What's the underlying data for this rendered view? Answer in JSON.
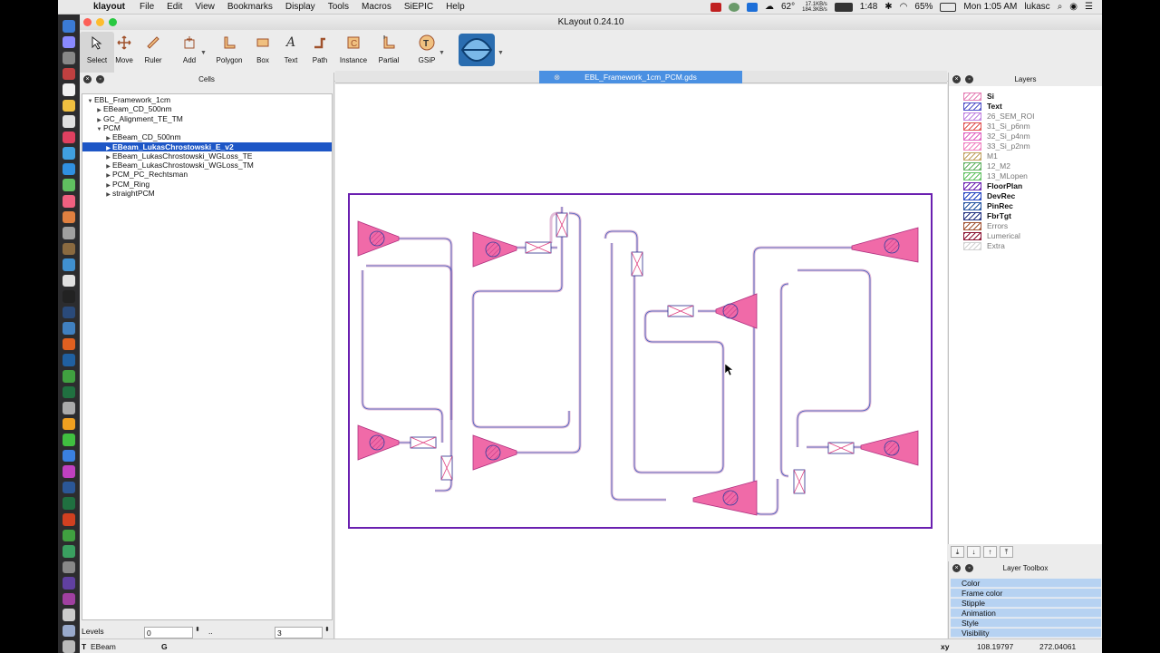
{
  "menubar": {
    "app_name": "klayout",
    "items": [
      "File",
      "Edit",
      "View",
      "Bookmarks",
      "Display",
      "Tools",
      "Macros",
      "SiEPIC",
      "Help"
    ],
    "temperature": "62°",
    "net_up": "17.1KB/s",
    "net_down": "184.3KB/s",
    "battery_time": "1:48",
    "battery_percent": "65%",
    "clock": "Mon 1:05 AM",
    "user": "lukasc"
  },
  "window": {
    "title": "KLayout 0.24.10"
  },
  "toolbar": {
    "tools": [
      {
        "label": "Select",
        "icon": "select-arrow-icon"
      },
      {
        "label": "Move",
        "icon": "move-icon"
      },
      {
        "label": "Ruler",
        "icon": "ruler-icon"
      },
      {
        "label": "Add",
        "icon": "add-icon"
      },
      {
        "label": "Polygon",
        "icon": "polygon-icon"
      },
      {
        "label": "Box",
        "icon": "box-icon"
      },
      {
        "label": "Text",
        "icon": "text-icon"
      },
      {
        "label": "Path",
        "icon": "path-icon"
      },
      {
        "label": "Instance",
        "icon": "instance-icon"
      },
      {
        "label": "Partial",
        "icon": "partial-icon"
      },
      {
        "label": "GSiP",
        "icon": "gsip-icon"
      }
    ]
  },
  "cells": {
    "title": "Cells",
    "tree": [
      {
        "label": "EBL_Framework_1cm",
        "arrow": "▼",
        "selected": false
      },
      {
        "label": "EBeam_CD_500nm",
        "arrow": "▶",
        "selected": false
      },
      {
        "label": "GC_Alignment_TE_TM",
        "arrow": "▶",
        "selected": false
      },
      {
        "label": "PCM",
        "arrow": "▼",
        "selected": false
      },
      {
        "label": "EBeam_CD_500nm",
        "arrow": "▶",
        "selected": false
      },
      {
        "label": "EBeam_LukasChrostowski_E_v2",
        "arrow": "▶",
        "selected": true
      },
      {
        "label": "EBeam_LukasChrostowski_WGLoss_TE",
        "arrow": "▶",
        "selected": false
      },
      {
        "label": "EBeam_LukasChrostowski_WGLoss_TM",
        "arrow": "▶",
        "selected": false
      },
      {
        "label": "PCM_PC_Rechtsman",
        "arrow": "▶",
        "selected": false
      },
      {
        "label": "PCM_Ring",
        "arrow": "▶",
        "selected": false
      },
      {
        "label": "straightPCM",
        "arrow": "▶",
        "selected": false
      }
    ],
    "levels_label": "Levels",
    "level_from": "0",
    "level_sep": "..",
    "level_to": "3"
  },
  "tab": {
    "filename": "EBL_Framework_1cm_PCM.gds"
  },
  "layers": {
    "title": "Layers",
    "items": [
      {
        "name": "Si",
        "style": "bold",
        "color": "#e57fb5"
      },
      {
        "name": "Text",
        "style": "bold",
        "color": "#5050c8"
      },
      {
        "name": "26_SEM_ROI",
        "style": "dim",
        "color": "#c080e0"
      },
      {
        "name": "31_Si_p6nm",
        "style": "dim",
        "color": "#e05050"
      },
      {
        "name": "32_Si_p4nm",
        "style": "dim",
        "color": "#e060c0"
      },
      {
        "name": "33_Si_p2nm",
        "style": "dim",
        "color": "#f080c0"
      },
      {
        "name": "M1",
        "style": "dim",
        "color": "#c0a060"
      },
      {
        "name": "12_M2",
        "style": "dim",
        "color": "#60b060"
      },
      {
        "name": "13_MLopen",
        "style": "dim",
        "color": "#60c060"
      },
      {
        "name": "FloorPlan",
        "style": "bold",
        "color": "#6a1fb0"
      },
      {
        "name": "DevRec",
        "style": "bold",
        "color": "#2040c0"
      },
      {
        "name": "PinRec",
        "style": "bold",
        "color": "#2050a0"
      },
      {
        "name": "FbrTgt",
        "style": "bold",
        "color": "#203080"
      },
      {
        "name": "Errors",
        "style": "dim",
        "color": "#a05030"
      },
      {
        "name": "Lumerical",
        "style": "dim",
        "color": "#8a1030"
      },
      {
        "name": "Extra",
        "style": "dim",
        "color": "#d0d0d0"
      }
    ]
  },
  "toolbox": {
    "title": "Layer Toolbox",
    "rows": [
      "Color",
      "Frame color",
      "Stipple",
      "Animation",
      "Style",
      "Visibility"
    ]
  },
  "status": {
    "left_label": "T",
    "left_value": "EBeam",
    "g_label": "G",
    "xy_label": "xy",
    "x": "108.19797",
    "y": "272.04061"
  }
}
